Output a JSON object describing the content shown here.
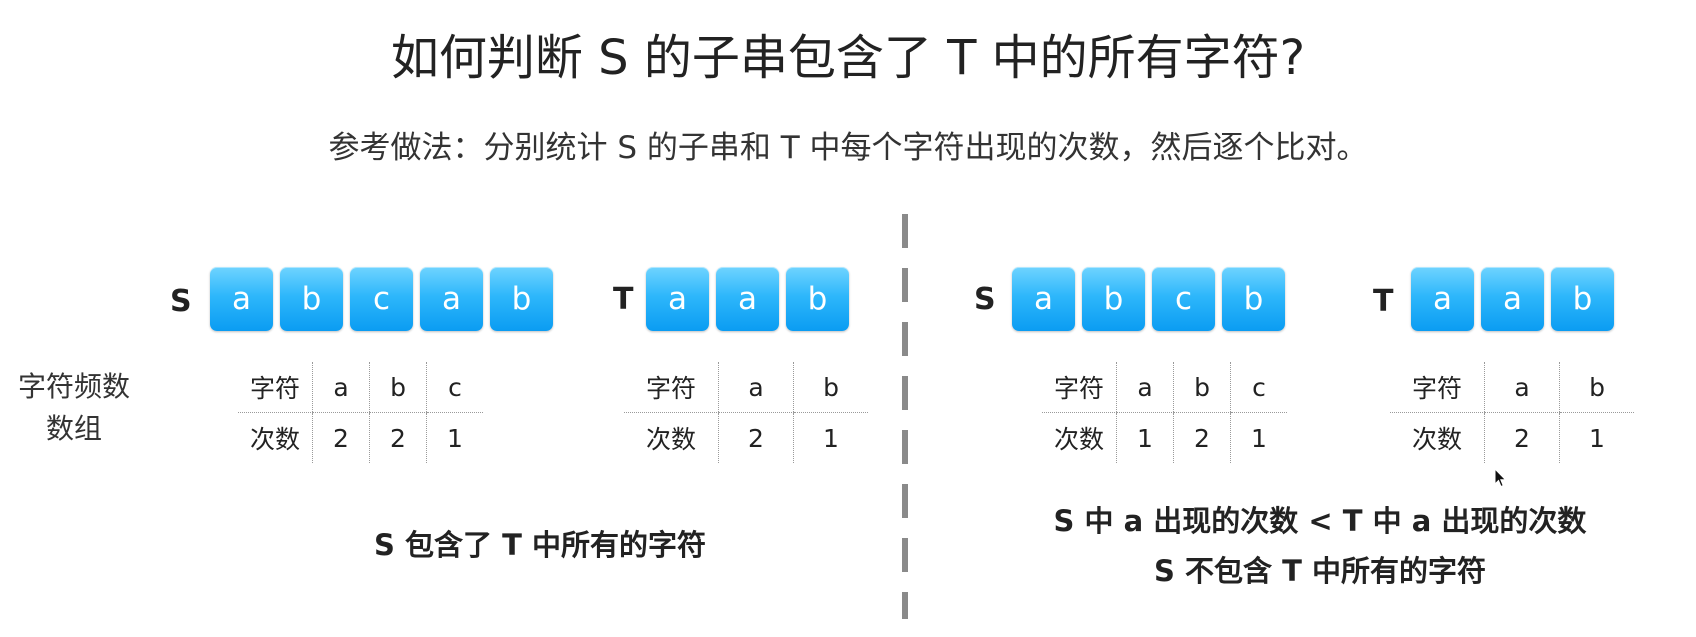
{
  "title": "如何判断 S 的子串包含了 T 中的所有字符?",
  "subtitle": "参考做法：分别统计 S 的子串和 T 中每个字符出现的次数，然后逐个比对。",
  "side_label": {
    "line1": "字符频数",
    "line2": "数组"
  },
  "cell_color": "#1aa9f7",
  "left": {
    "s": {
      "label": "S",
      "chars": [
        "a",
        "b",
        "c",
        "a",
        "b"
      ]
    },
    "t": {
      "label": "T",
      "chars": [
        "a",
        "a",
        "b"
      ]
    },
    "s_table": {
      "header": [
        "字符",
        "a",
        "b",
        "c"
      ],
      "counts": [
        "次数",
        "2",
        "2",
        "1"
      ]
    },
    "t_table": {
      "header": [
        "字符",
        "a",
        "b"
      ],
      "counts": [
        "次数",
        "2",
        "1"
      ]
    },
    "conclusion": "S 包含了 T 中所有的字符"
  },
  "right": {
    "s": {
      "label": "S",
      "chars": [
        "a",
        "b",
        "c",
        "b"
      ]
    },
    "t": {
      "label": "T",
      "chars": [
        "a",
        "a",
        "b"
      ]
    },
    "s_table": {
      "header": [
        "字符",
        "a",
        "b",
        "c"
      ],
      "counts": [
        "次数",
        "1",
        "2",
        "1"
      ]
    },
    "t_table": {
      "header": [
        "字符",
        "a",
        "b"
      ],
      "counts": [
        "次数",
        "2",
        "1"
      ]
    },
    "conclusion_line1": "S 中 a 出现的次数 < T 中 a 出现的次数",
    "conclusion_line2": "S 不包含 T 中所有的字符"
  }
}
